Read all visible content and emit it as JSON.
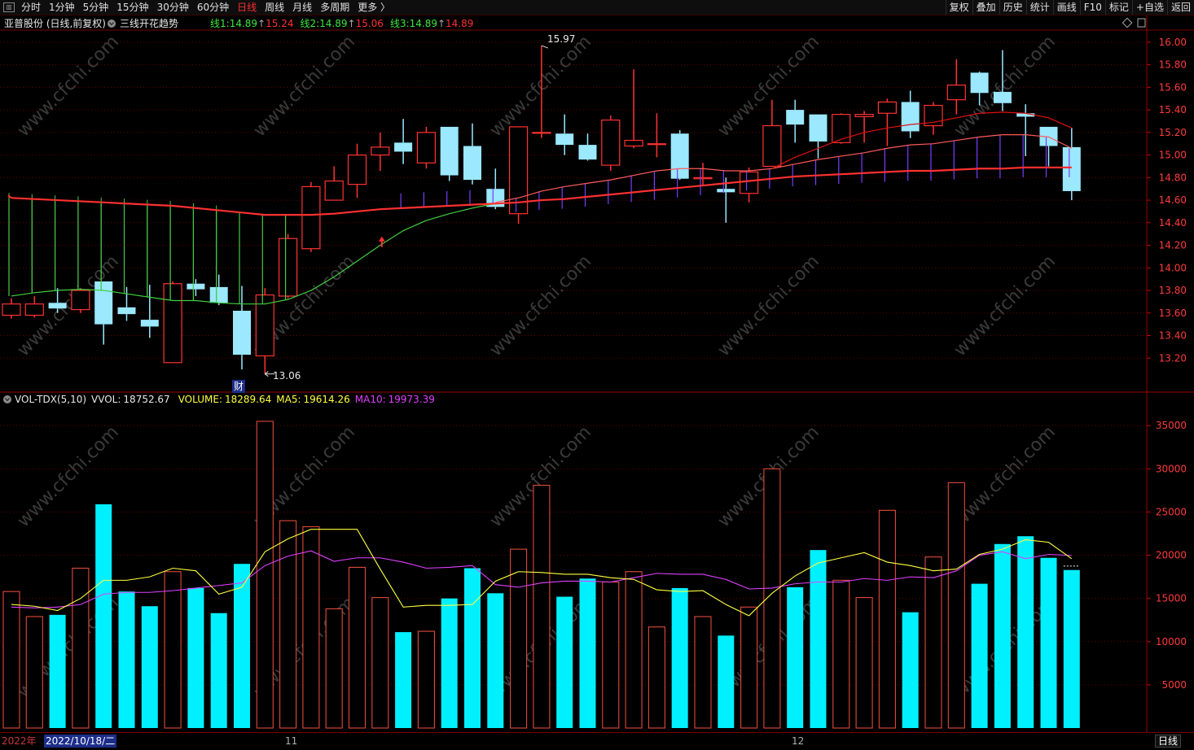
{
  "toolbar": {
    "left_items": [
      "分时",
      "1分钟",
      "5分钟",
      "15分钟",
      "30分钟",
      "60分钟",
      "日线",
      "周线",
      "月线",
      "多周期",
      "更多 〉"
    ],
    "active_index": 6,
    "right_items": [
      "复权",
      "叠加",
      "历史",
      "统计",
      "画线",
      "F10",
      "标记",
      "+自选",
      "返回"
    ]
  },
  "main_panel": {
    "title": "亚普股份 (日线,前复权)",
    "indicator_name": "三线开花趋势",
    "lines": [
      {
        "label": "线1:",
        "value": "14.89",
        "up": "15.24"
      },
      {
        "label": "线2:",
        "value": "14.89",
        "up": "15.06"
      },
      {
        "label": "线3:",
        "value": "14.89",
        "up": "14.89"
      }
    ],
    "high_label": "15.97",
    "low_label": "13.06",
    "fin_marker": "财",
    "y_ticks": [
      "16.00",
      "15.80",
      "15.60",
      "15.40",
      "15.20",
      "15.00",
      "14.80",
      "14.60",
      "14.40",
      "14.20",
      "14.00",
      "13.80",
      "13.60",
      "13.40",
      "13.20"
    ]
  },
  "vol_panel": {
    "name": "VOL-TDX(5,10)",
    "vvol_label": "VVOL:",
    "vvol_value": "18752.67",
    "volume_label": "VOLUME:",
    "volume_value": "18289.64",
    "ma5_label": "MA5:",
    "ma5_value": "19614.26",
    "ma10_label": "MA10:",
    "ma10_value": "19973.39",
    "y_ticks": [
      "35000",
      "30000",
      "25000",
      "20000",
      "15000",
      "10000",
      "5000"
    ]
  },
  "bottom": {
    "year": "2022年",
    "date": "2022/10/18/二",
    "month_11": "11",
    "month_12": "12",
    "period": "日线"
  },
  "colors": {
    "up": "#ff3232",
    "down": "#9be8ff",
    "vol_down": "#00f0ff",
    "line1": "#ff3030",
    "line2": "#ff5a5a",
    "line3": "#e01010",
    "ma_green": "#40e040",
    "ma_yellow": "#ffff40",
    "ma_magenta": "#e040ff",
    "grid": "#6a0000"
  },
  "chart_data": {
    "type": "candlestick",
    "price_ylim": [
      13.0,
      16.1
    ],
    "volume_ylim": [
      0,
      37000
    ],
    "candles": [
      {
        "o": 13.58,
        "h": 13.73,
        "l": 13.55,
        "c": 13.68,
        "v": 15800
      },
      {
        "o": 13.58,
        "h": 13.75,
        "l": 13.56,
        "c": 13.68,
        "v": 12900
      },
      {
        "o": 13.69,
        "h": 13.82,
        "l": 13.6,
        "c": 13.64,
        "v": 13100
      },
      {
        "o": 13.63,
        "h": 13.82,
        "l": 13.6,
        "c": 13.8,
        "v": 18500
      },
      {
        "o": 13.88,
        "h": 13.88,
        "l": 13.32,
        "c": 13.5,
        "v": 25900
      },
      {
        "o": 13.65,
        "h": 13.83,
        "l": 13.53,
        "c": 13.59,
        "v": 15800
      },
      {
        "o": 13.54,
        "h": 13.85,
        "l": 13.38,
        "c": 13.48,
        "v": 14100
      },
      {
        "o": 13.16,
        "h": 13.88,
        "l": 13.16,
        "c": 13.86,
        "v": 18100
      },
      {
        "o": 13.86,
        "h": 13.9,
        "l": 13.75,
        "c": 13.81,
        "v": 16200
      },
      {
        "o": 13.83,
        "h": 13.94,
        "l": 13.67,
        "c": 13.69,
        "v": 13300
      },
      {
        "o": 13.62,
        "h": 13.84,
        "l": 13.1,
        "c": 13.23,
        "v": 19000
      },
      {
        "o": 13.22,
        "h": 13.82,
        "l": 13.06,
        "c": 13.76,
        "v": 35500
      },
      {
        "o": 13.75,
        "h": 14.3,
        "l": 13.73,
        "c": 14.26,
        "v": 24000
      },
      {
        "o": 14.17,
        "h": 14.76,
        "l": 14.14,
        "c": 14.72,
        "v": 23300
      },
      {
        "o": 14.6,
        "h": 14.9,
        "l": 14.6,
        "c": 14.77,
        "v": 13800
      },
      {
        "o": 14.74,
        "h": 15.1,
        "l": 14.62,
        "c": 15.0,
        "v": 18600
      },
      {
        "o": 15.0,
        "h": 15.2,
        "l": 14.86,
        "c": 15.07,
        "v": 15100
      },
      {
        "o": 15.11,
        "h": 15.32,
        "l": 14.92,
        "c": 15.03,
        "v": 11100
      },
      {
        "o": 14.93,
        "h": 15.25,
        "l": 14.88,
        "c": 15.2,
        "v": 11200
      },
      {
        "o": 15.25,
        "h": 15.25,
        "l": 14.77,
        "c": 14.82,
        "v": 15000
      },
      {
        "o": 15.08,
        "h": 15.28,
        "l": 14.74,
        "c": 14.78,
        "v": 18500
      },
      {
        "o": 14.7,
        "h": 14.88,
        "l": 14.52,
        "c": 14.54,
        "v": 15600
      },
      {
        "o": 14.48,
        "h": 15.25,
        "l": 14.39,
        "c": 15.25,
        "v": 20700
      },
      {
        "o": 15.2,
        "h": 15.97,
        "l": 15.15,
        "c": 15.2,
        "v": 28100
      },
      {
        "o": 15.19,
        "h": 15.36,
        "l": 15.0,
        "c": 15.09,
        "v": 15200
      },
      {
        "o": 15.09,
        "h": 15.19,
        "l": 14.95,
        "c": 14.96,
        "v": 17300
      },
      {
        "o": 14.91,
        "h": 15.35,
        "l": 14.86,
        "c": 15.31,
        "v": 16900
      },
      {
        "o": 15.08,
        "h": 15.76,
        "l": 15.06,
        "c": 15.13,
        "v": 18100
      },
      {
        "o": 15.1,
        "h": 15.37,
        "l": 14.98,
        "c": 15.1,
        "v": 11700
      },
      {
        "o": 15.19,
        "h": 15.22,
        "l": 14.78,
        "c": 14.79,
        "v": 16200
      },
      {
        "o": 14.79,
        "h": 14.93,
        "l": 14.73,
        "c": 14.8,
        "v": 12900
      },
      {
        "o": 14.7,
        "h": 14.8,
        "l": 14.4,
        "c": 14.67,
        "v": 10700
      },
      {
        "o": 14.66,
        "h": 14.89,
        "l": 14.58,
        "c": 14.85,
        "v": 14000
      },
      {
        "o": 14.9,
        "h": 15.49,
        "l": 14.9,
        "c": 15.26,
        "v": 30000
      },
      {
        "o": 15.4,
        "h": 15.49,
        "l": 15.11,
        "c": 15.27,
        "v": 16300
      },
      {
        "o": 15.36,
        "h": 15.36,
        "l": 14.97,
        "c": 15.12,
        "v": 20600
      },
      {
        "o": 15.11,
        "h": 15.37,
        "l": 15.1,
        "c": 15.36,
        "v": 17100
      },
      {
        "o": 15.34,
        "h": 15.39,
        "l": 15.11,
        "c": 15.36,
        "v": 15100
      },
      {
        "o": 15.37,
        "h": 15.5,
        "l": 15.08,
        "c": 15.47,
        "v": 25200
      },
      {
        "o": 15.47,
        "h": 15.57,
        "l": 15.15,
        "c": 15.21,
        "v": 13400
      },
      {
        "o": 15.26,
        "h": 15.47,
        "l": 15.18,
        "c": 15.44,
        "v": 19800
      },
      {
        "o": 15.49,
        "h": 15.85,
        "l": 15.36,
        "c": 15.62,
        "v": 28400
      },
      {
        "o": 15.73,
        "h": 15.74,
        "l": 15.44,
        "c": 15.55,
        "v": 16700
      },
      {
        "o": 15.56,
        "h": 15.93,
        "l": 15.39,
        "c": 15.46,
        "v": 21300
      },
      {
        "o": 15.37,
        "h": 15.45,
        "l": 14.99,
        "c": 15.34,
        "v": 22200
      },
      {
        "o": 15.25,
        "h": 15.25,
        "l": 14.9,
        "c": 15.08,
        "v": 19700
      },
      {
        "o": 15.07,
        "h": 15.24,
        "l": 14.6,
        "c": 14.68,
        "v": 18290
      }
    ],
    "ma5": [
      14300,
      14100,
      13600,
      15000,
      17100,
      17100,
      17500,
      18500,
      18200,
      15500,
      16300,
      20400,
      21900,
      23000,
      23000,
      23000,
      18400,
      14000,
      14200,
      14200,
      14300,
      17000,
      18100,
      18000,
      17800,
      17800,
      17400,
      17200,
      16000,
      15800,
      15900,
      14300,
      13000,
      15600,
      17600,
      19100,
      19700,
      20300,
      19200,
      18800,
      18200,
      18400,
      20100,
      20700,
      21800,
      21500,
      19600
    ],
    "ma10": [
      14000,
      13900,
      14000,
      14300,
      15500,
      15700,
      15700,
      15900,
      16200,
      16500,
      16800,
      18800,
      19900,
      20500,
      19300,
      19700,
      19700,
      19200,
      18500,
      18600,
      18800,
      16600,
      16300,
      16800,
      17000,
      17000,
      16900,
      17400,
      17900,
      17800,
      17800,
      17200,
      16100,
      16200,
      16700,
      16900,
      16900,
      17300,
      17100,
      17500,
      17400,
      18200,
      20000,
      20400,
      19600,
      20100,
      19970
    ],
    "overlay_lines": {
      "line1": [
        14.62,
        14.61,
        14.6,
        14.59,
        14.58,
        14.57,
        14.56,
        14.55,
        14.53,
        14.51,
        14.49,
        14.47,
        14.47,
        14.47,
        14.48,
        14.5,
        14.52,
        14.53,
        14.54,
        14.55,
        14.56,
        14.57,
        14.58,
        14.6,
        14.61,
        14.63,
        14.65,
        14.67,
        14.69,
        14.71,
        14.73,
        14.75,
        14.77,
        14.79,
        14.81,
        14.82,
        14.83,
        14.84,
        14.85,
        14.86,
        14.86,
        14.87,
        14.88,
        14.88,
        14.89,
        14.89,
        14.89
      ],
      "line2": [
        null,
        null,
        null,
        null,
        null,
        null,
        null,
        null,
        null,
        null,
        null,
        null,
        null,
        null,
        null,
        null,
        null,
        null,
        null,
        null,
        null,
        14.58,
        14.62,
        14.68,
        14.72,
        14.75,
        14.78,
        14.82,
        14.86,
        14.88,
        14.88,
        14.86,
        14.86,
        14.88,
        14.92,
        14.96,
        14.99,
        15.02,
        15.06,
        15.09,
        15.1,
        15.13,
        15.16,
        15.18,
        15.18,
        15.16,
        15.06
      ],
      "line3": [
        null,
        null,
        null,
        null,
        null,
        null,
        null,
        null,
        null,
        null,
        null,
        null,
        null,
        null,
        null,
        null,
        null,
        null,
        null,
        null,
        null,
        null,
        null,
        null,
        null,
        null,
        null,
        null,
        null,
        null,
        null,
        null,
        null,
        14.88,
        14.98,
        15.06,
        15.14,
        15.2,
        15.24,
        15.27,
        15.29,
        15.33,
        15.37,
        15.38,
        15.37,
        15.33,
        15.24
      ],
      "ma_green_a": [
        13.75,
        13.78,
        13.8,
        13.81,
        13.8,
        13.77,
        13.74,
        13.71,
        13.71,
        13.69,
        13.68,
        13.68,
        13.72,
        13.8,
        13.92,
        14.06,
        14.2,
        14.33,
        14.42,
        14.48,
        14.53,
        14.57
      ]
    }
  }
}
